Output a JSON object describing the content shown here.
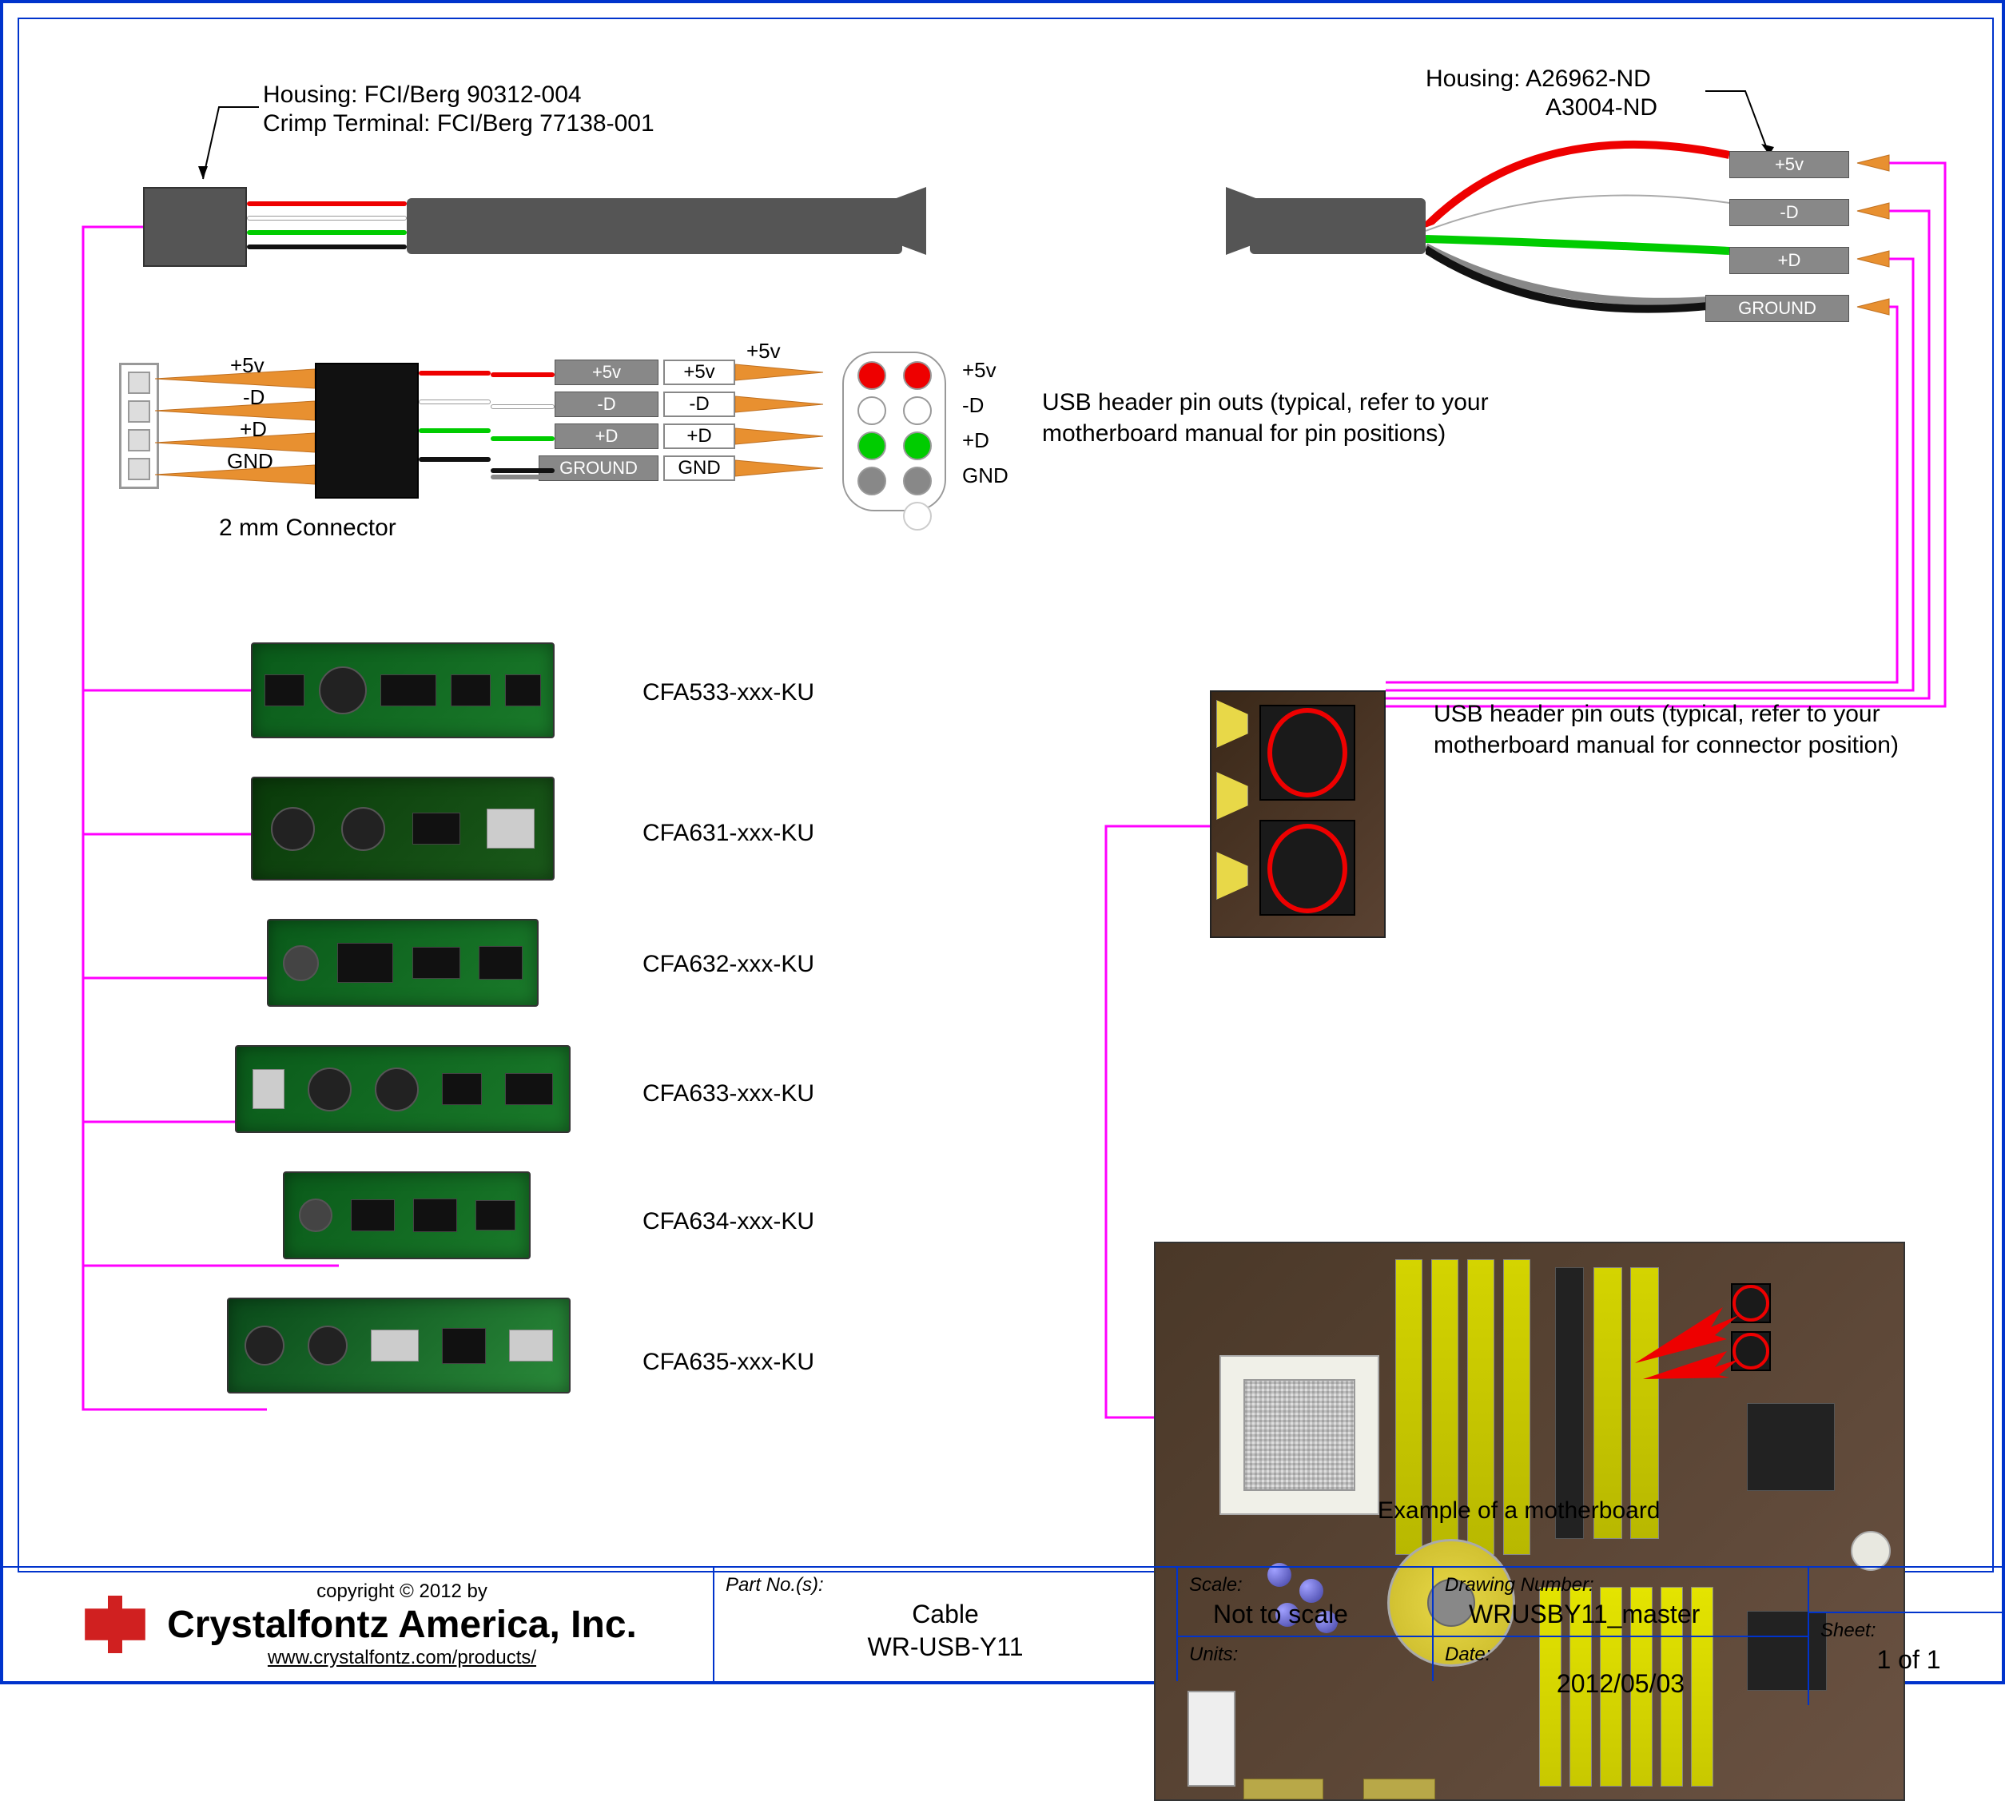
{
  "left_connector": {
    "housing": "Housing: FCI/Berg 90312-004",
    "crimp": "Crimp Terminal: FCI/Berg 77138-001"
  },
  "right_connector": {
    "housing": "Housing: A26962-ND",
    "alt": "A3004-ND"
  },
  "pin_labels": {
    "v5": "+5v",
    "dneg": "-D",
    "dpos": "+D",
    "gnd": "GND",
    "ground": "GROUND"
  },
  "conn_2mm": "2 mm Connector",
  "usb_note_top": "USB header pin outs (typical, refer to your motherboard manual for pin positions)",
  "usb_note_mid": "USB header pin outs (typical, refer to your motherboard manual for connector position)",
  "modules": [
    "CFA533-xxx-KU",
    "CFA631-xxx-KU",
    "CFA632-xxx-KU",
    "CFA633-xxx-KU",
    "CFA634-xxx-KU",
    "CFA635-xxx-KU"
  ],
  "mobo_caption": "Example of a motherboard",
  "title_block": {
    "copyright": "copyright © 2012 by",
    "company": "Crystalfontz America, Inc.",
    "url": "www.crystalfontz.com/products/",
    "part_label": "Part No.(s):",
    "part_desc": "Cable",
    "part_no": "WR-USB-Y11",
    "scale_label": "Scale:",
    "scale": "Not to scale",
    "units_label": "Units:",
    "dwg_label": "Drawing Number:",
    "dwg": "WRUSBY11_master",
    "date_label": "Date:",
    "date": "2012/05/03",
    "sheet_label": "Sheet:",
    "sheet": "1  of  1"
  }
}
